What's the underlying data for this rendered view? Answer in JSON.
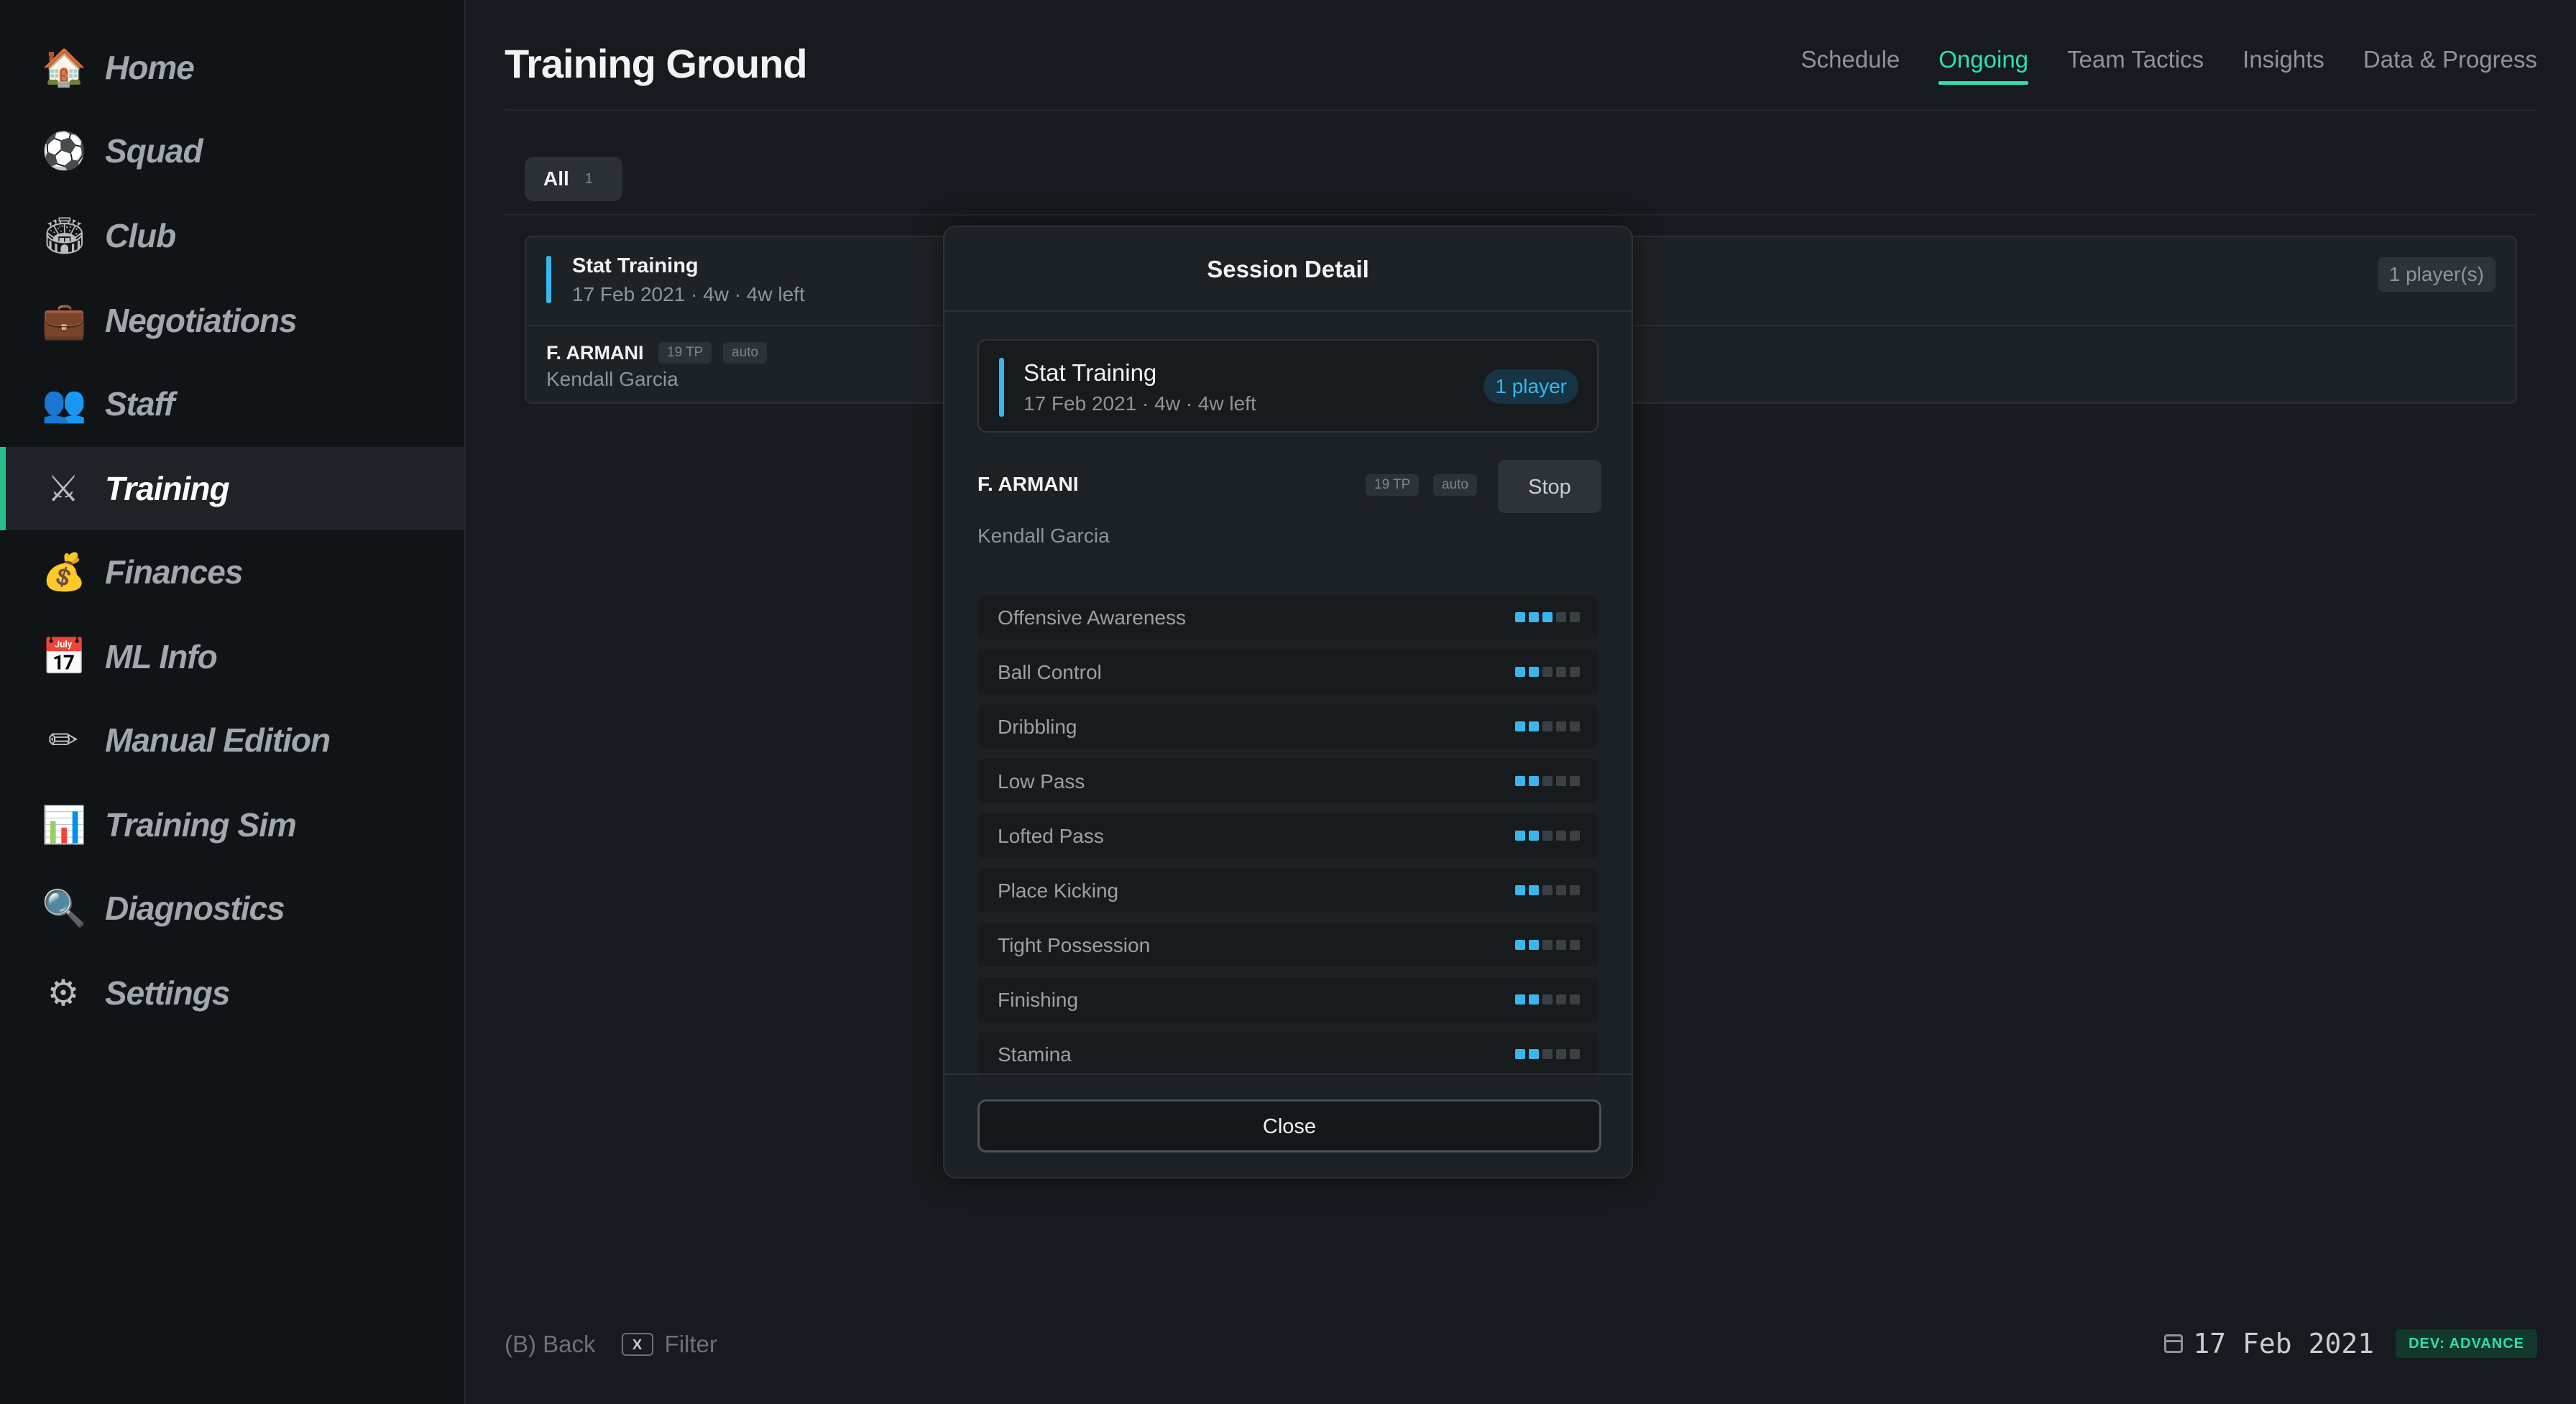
{
  "sidebar": {
    "items": [
      {
        "label": "Home",
        "icon": "🏠",
        "icon_name": "house-icon"
      },
      {
        "label": "Squad",
        "icon": "⚽",
        "icon_name": "soccer-ball-icon"
      },
      {
        "label": "Club",
        "icon": "🏟",
        "icon_name": "stadium-icon"
      },
      {
        "label": "Negotiations",
        "icon": "💼",
        "icon_name": "briefcase-icon"
      },
      {
        "label": "Staff",
        "icon": "👥",
        "icon_name": "people-icon"
      },
      {
        "label": "Training",
        "icon": "⚔",
        "icon_name": "crossed-swords-icon",
        "active": true
      },
      {
        "label": "Finances",
        "icon": "💰",
        "icon_name": "money-bag-icon"
      },
      {
        "label": "ML Info",
        "icon": "📅",
        "icon_name": "calendar-icon"
      },
      {
        "label": "Manual Edition",
        "icon": "✏",
        "icon_name": "pencil-icon"
      },
      {
        "label": "Training Sim",
        "icon": "📊",
        "icon_name": "bar-chart-icon"
      },
      {
        "label": "Diagnostics",
        "icon": "🔍",
        "icon_name": "magnifier-icon"
      },
      {
        "label": "Settings",
        "icon": "⚙",
        "icon_name": "gear-icon"
      }
    ]
  },
  "header": {
    "title": "Training Ground",
    "tabs": [
      {
        "label": "Schedule"
      },
      {
        "label": "Ongoing",
        "active": true
      },
      {
        "label": "Team Tactics"
      },
      {
        "label": "Insights"
      },
      {
        "label": "Data & Progress"
      }
    ]
  },
  "filter": {
    "label": "All",
    "count": "1"
  },
  "session_card": {
    "title": "Stat Training",
    "meta": "17 Feb 2021 · 4w · 4w left",
    "players": "1 player(s)",
    "player": {
      "name": "F. ARMANI",
      "tp": "19 TP",
      "mode": "auto",
      "coach": "Kendall Garcia"
    }
  },
  "modal": {
    "title": "Session Detail",
    "session_title": "Stat Training",
    "session_meta": "17 Feb 2021 · 4w · 4w left",
    "player_count": "1 player",
    "player": {
      "name": "F. ARMANI",
      "tp": "19 TP",
      "mode": "auto",
      "coach": "Kendall Garcia",
      "stop_label": "Stop"
    },
    "stats": [
      {
        "label": "Offensive Awareness",
        "level": 3,
        "max": 5
      },
      {
        "label": "Ball Control",
        "level": 2,
        "max": 5
      },
      {
        "label": "Dribbling",
        "level": 2,
        "max": 5
      },
      {
        "label": "Low Pass",
        "level": 2,
        "max": 5
      },
      {
        "label": "Lofted Pass",
        "level": 2,
        "max": 5
      },
      {
        "label": "Place Kicking",
        "level": 2,
        "max": 5
      },
      {
        "label": "Tight Possession",
        "level": 2,
        "max": 5
      },
      {
        "label": "Finishing",
        "level": 2,
        "max": 5
      },
      {
        "label": "Stamina",
        "level": 2,
        "max": 5
      }
    ],
    "close_label": "Close"
  },
  "footer": {
    "back_hint": "(B) Back",
    "filter_key": "X",
    "filter_hint": "Filter",
    "date": "17 Feb 2021",
    "dev_badge": "DEV: ADVANCE"
  },
  "colors": {
    "accent_green": "#2de0ae",
    "accent_blue": "#3bb6ec",
    "active_bar": "#24c28a"
  }
}
